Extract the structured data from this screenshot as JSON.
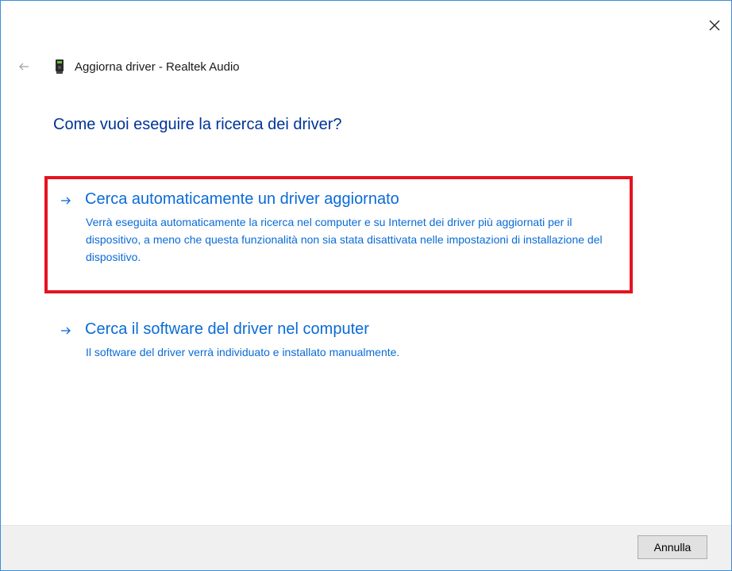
{
  "window": {
    "header_title": "Aggiorna driver - Realtek Audio"
  },
  "main": {
    "heading": "Come vuoi eseguire la ricerca dei driver?",
    "options": [
      {
        "title": "Cerca automaticamente un driver aggiornato",
        "description": "Verrà eseguita automaticamente la ricerca nel computer e su Internet dei driver più aggiornati per il dispositivo, a meno che questa funzionalità non sia stata disattivata nelle impostazioni di installazione del dispositivo.",
        "highlighted": true
      },
      {
        "title": "Cerca il software del driver nel computer",
        "description": "Il software del driver verrà individuato e installato manualmente.",
        "highlighted": false
      }
    ]
  },
  "footer": {
    "cancel_label": "Annulla"
  },
  "icons": {
    "close": "close-icon",
    "back": "back-arrow-icon",
    "device": "audio-device-icon",
    "option_arrow": "arrow-right-icon"
  },
  "colors": {
    "link_blue": "#0a6bd6",
    "heading_blue": "#003399",
    "highlight_red": "#e5131f",
    "window_border": "#3c8fd6"
  }
}
